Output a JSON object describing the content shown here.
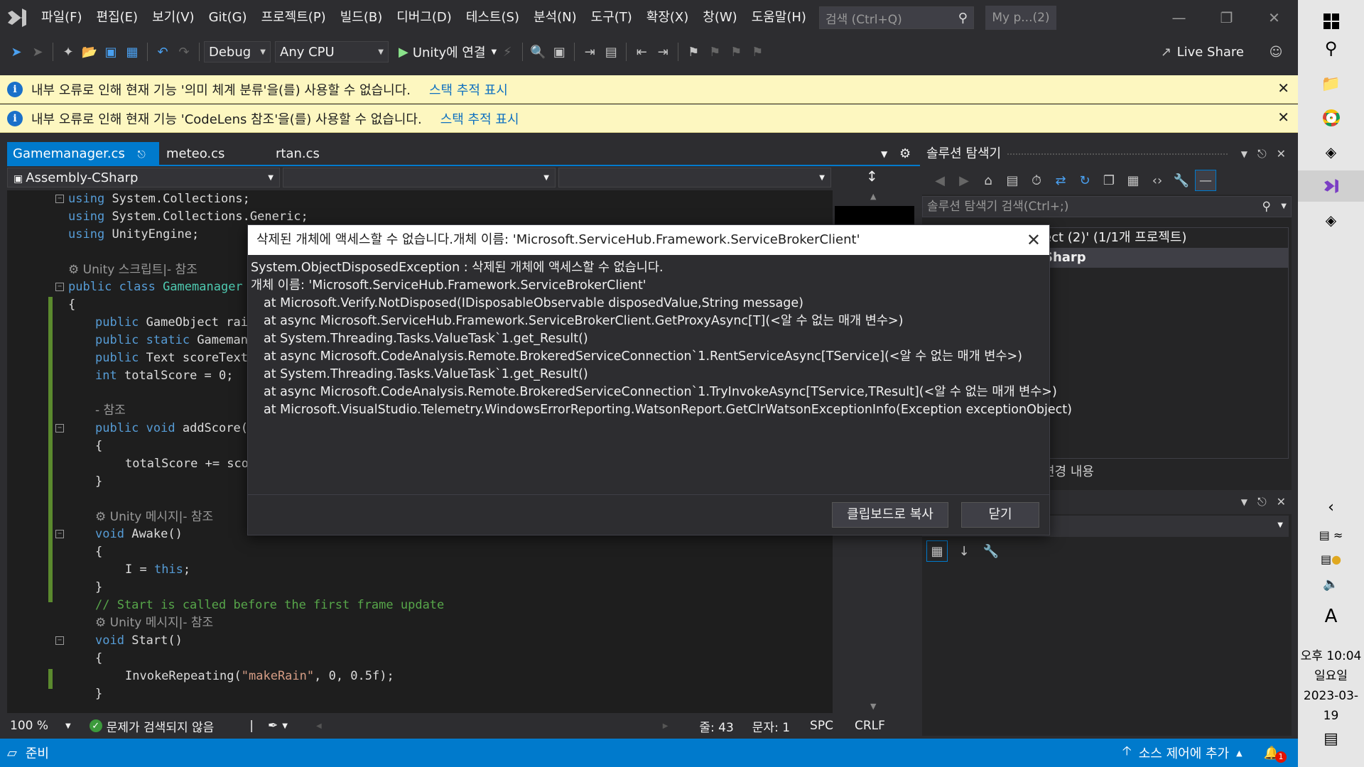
{
  "menu": {
    "items": [
      "파일(F)",
      "편집(E)",
      "보기(V)",
      "Git(G)",
      "프로젝트(P)",
      "빌드(B)",
      "디버그(D)",
      "테스트(S)",
      "분석(N)",
      "도구(T)",
      "확장(X)",
      "창(W)",
      "도움말(H)"
    ],
    "search_placeholder": "검색 (Ctrl+Q)",
    "profile_label": "My p...(2)"
  },
  "toolbar": {
    "config": "Debug",
    "platform": "Any CPU",
    "run_label": "Unity에 연결",
    "live_share": "Live Share"
  },
  "infobars": [
    {
      "message": "내부 오류로 인해 현재 기능 '의미 체계 분류'을(를) 사용할 수 없습니다.",
      "link": "스택 추적 표시"
    },
    {
      "message": "내부 오류로 인해 현재 기능 'CodeLens 참조'을(를) 사용할 수 없습니다.",
      "link": "스택 추적 표시"
    }
  ],
  "tabs": [
    "Gamemanager.cs",
    "meteo.cs",
    "rtan.cs"
  ],
  "nav": {
    "project": "Assembly-CSharp"
  },
  "code": {
    "l1": "System.Collections;",
    "l2": "System.Collections.Generic;",
    "l3": "UnityEngine;",
    "lens_script": "Unity 스크립트|- 참조",
    "class_name": "Gamemanager",
    "f1_type": "GameObject",
    "f1_name": "rai",
    "f2_type": "Gamemana",
    "f3_type": "Text",
    "f3_name": "scoreText",
    "f4": "totalScore = 0;",
    "lens_ref": "- 참조",
    "method1": "addScore(",
    "body1": "totalScore += sco",
    "lens_msg": "Unity 메시지|- 참조",
    "method2": "Awake()",
    "body2a": "I = ",
    "body2b": "this",
    "body2c": ";",
    "comment": "// Start is called before the first frame update",
    "method3": "Start()",
    "body3a": "InvokeRepeating(",
    "body3str": "\"makeRain\"",
    "body3b": ", 0, 0.5f);"
  },
  "editor_status": {
    "zoom": "100 %",
    "issues": "문제가 검색되지 않음",
    "line": "줄: 43",
    "col": "문자: 1",
    "spc": "SPC",
    "eol": "CRLF"
  },
  "solution": {
    "title": "솔루션 탐색기",
    "search_placeholder": "솔루션 탐색기 검색(Ctrl+;)",
    "tree_line1": "ect (2)' (1/1개 프로젝트)",
    "tree_line2": "Sharp",
    "changes": "변경 내용"
  },
  "statusbar": {
    "ready": "준비",
    "source_control": "소스 제어에 추가",
    "notifications": "1"
  },
  "clock": {
    "time": "오후 10:04",
    "day": "일요일",
    "date": "2023-03-19"
  },
  "taskbar": {
    "ime": "A"
  },
  "dialog": {
    "title": "삭제된 개체에 액세스할 수 없습니다.개체 이름: 'Microsoft.ServiceHub.Framework.ServiceBrokerClient'",
    "lines": [
      "System.ObjectDisposedException : 삭제된 개체에 액세스할 수 없습니다.",
      "개체 이름: 'Microsoft.ServiceHub.Framework.ServiceBrokerClient'"
    ],
    "stack": [
      "at Microsoft.Verify.NotDisposed(IDisposableObservable disposedValue,String message)",
      "at async Microsoft.ServiceHub.Framework.ServiceBrokerClient.GetProxyAsync[T](<알 수 없는 매개 변수>)",
      "at System.Threading.Tasks.ValueTask`1.get_Result()",
      "at async Microsoft.CodeAnalysis.Remote.BrokeredServiceConnection`1.RentServiceAsync[TService](<알 수 없는 매개 변수>)",
      "at System.Threading.Tasks.ValueTask`1.get_Result()",
      "at async Microsoft.CodeAnalysis.Remote.BrokeredServiceConnection`1.TryInvokeAsync[TService,TResult](<알 수 없는 매개 변수>)",
      "at Microsoft.VisualStudio.Telemetry.WindowsErrorReporting.WatsonReport.GetClrWatsonExceptionInfo(Exception exceptionObject)"
    ],
    "copy_button": "클립보드로 복사",
    "close_button": "닫기"
  }
}
